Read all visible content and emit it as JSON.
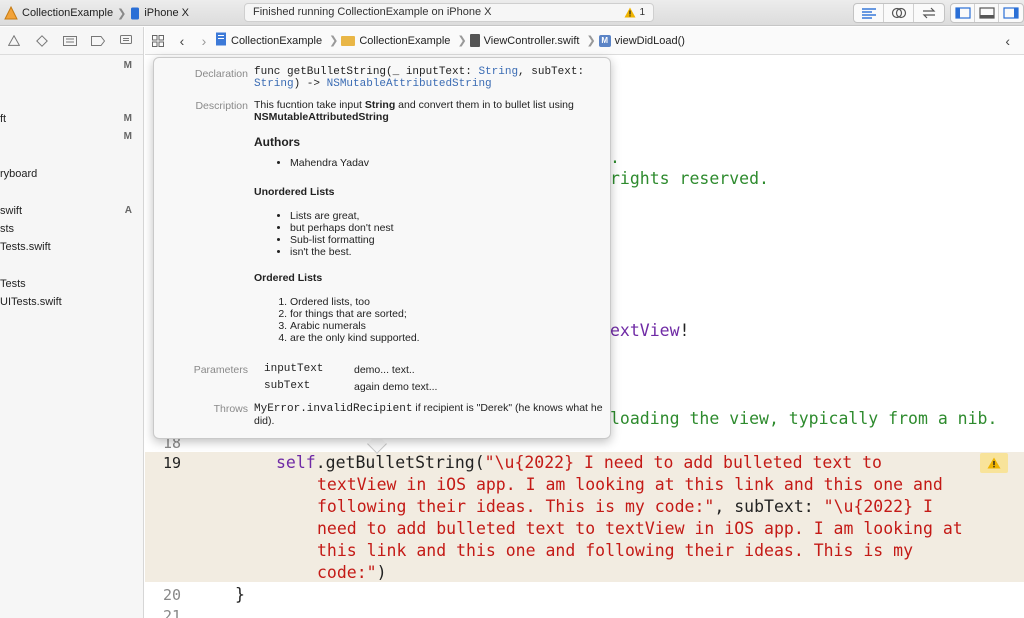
{
  "toolbar": {
    "scheme_name": "CollectionExample",
    "device_name": "iPhone X",
    "status_text": "Finished running CollectionExample on iPhone X",
    "warning_count": "1"
  },
  "navigator": {
    "items": [
      {
        "name": "",
        "badge": "M"
      },
      {
        "name": "ft",
        "badge": "M"
      },
      {
        "name": "",
        "badge": "M"
      },
      {
        "name": "ryboard",
        "badge": ""
      },
      {
        "name": "swift",
        "badge": "A"
      },
      {
        "name": "sts",
        "badge": ""
      },
      {
        "name": "Tests.swift",
        "badge": ""
      },
      {
        "name": "Tests",
        "badge": ""
      },
      {
        "name": "UITests.swift",
        "badge": ""
      }
    ]
  },
  "jumpbar": {
    "crumbs": [
      "CollectionExample",
      "CollectionExample",
      "ViewController.swift",
      "viewDidLoad()"
    ]
  },
  "editor": {
    "fragment_1": ".",
    "fragment_2": "rights reserved.",
    "fragment_3": "extView",
    "fragment_3b": "!",
    "fragment_4": "loading the view, typically from a nib.",
    "line_19_self": "self",
    "line_19_call": ".getBulletString(",
    "line_19_str1": "\"\\u{2022} I need to add bulleted text to",
    "line_19_str2": "textView in iOS app. I am looking at this link and this one and",
    "line_19_str3": "following their ideas. This is my code:\"",
    "line_19_label": ", subText: ",
    "line_19_str4": "\"\\u{2022} I",
    "line_19_str5": "need to add bulleted text to textView in iOS app. I am looking at",
    "line_19_str6": "this link and this one and following their ideas. This is my",
    "line_19_str7": "code:\"",
    "line_19_close": ")",
    "line_20": "}",
    "line_numbers": {
      "n18": "18",
      "n19": "19",
      "n20": "20",
      "n21": "21"
    }
  },
  "quick_help": {
    "declaration_label": "Declaration",
    "declaration_1": "func getBulletString(_ inputText: ",
    "declaration_type1": "String",
    "declaration_2": ", subText:",
    "declaration_type2": "String",
    "declaration_3": ") -> ",
    "declaration_type3": "NSMutableAttributedString",
    "description_label": "Description",
    "description_a": "This fucntion take input ",
    "description_b": "String",
    "description_c": " and convert them in to bullet list using",
    "description_d": "NSMutableAttributedString",
    "authors_heading": "Authors",
    "authors": [
      "Mahendra Yadav"
    ],
    "unordered_heading": "Unordered Lists",
    "unordered": [
      "Lists are great,",
      "but perhaps don't nest",
      "Sub-list formatting",
      "isn't the best."
    ],
    "ordered_heading": "Ordered Lists",
    "ordered": [
      "Ordered lists, too",
      "for things that are sorted;",
      "Arabic numerals",
      "are the only kind supported."
    ],
    "parameters_label": "Parameters",
    "params": [
      {
        "name": "inputText",
        "desc": "demo... text.."
      },
      {
        "name": "subText",
        "desc": "again demo text..."
      }
    ],
    "throws_label": "Throws",
    "throws_code": "MyError.invalidRecipient",
    "throws_text": " if recipient is \"Derek\" (he knows what he did)."
  }
}
